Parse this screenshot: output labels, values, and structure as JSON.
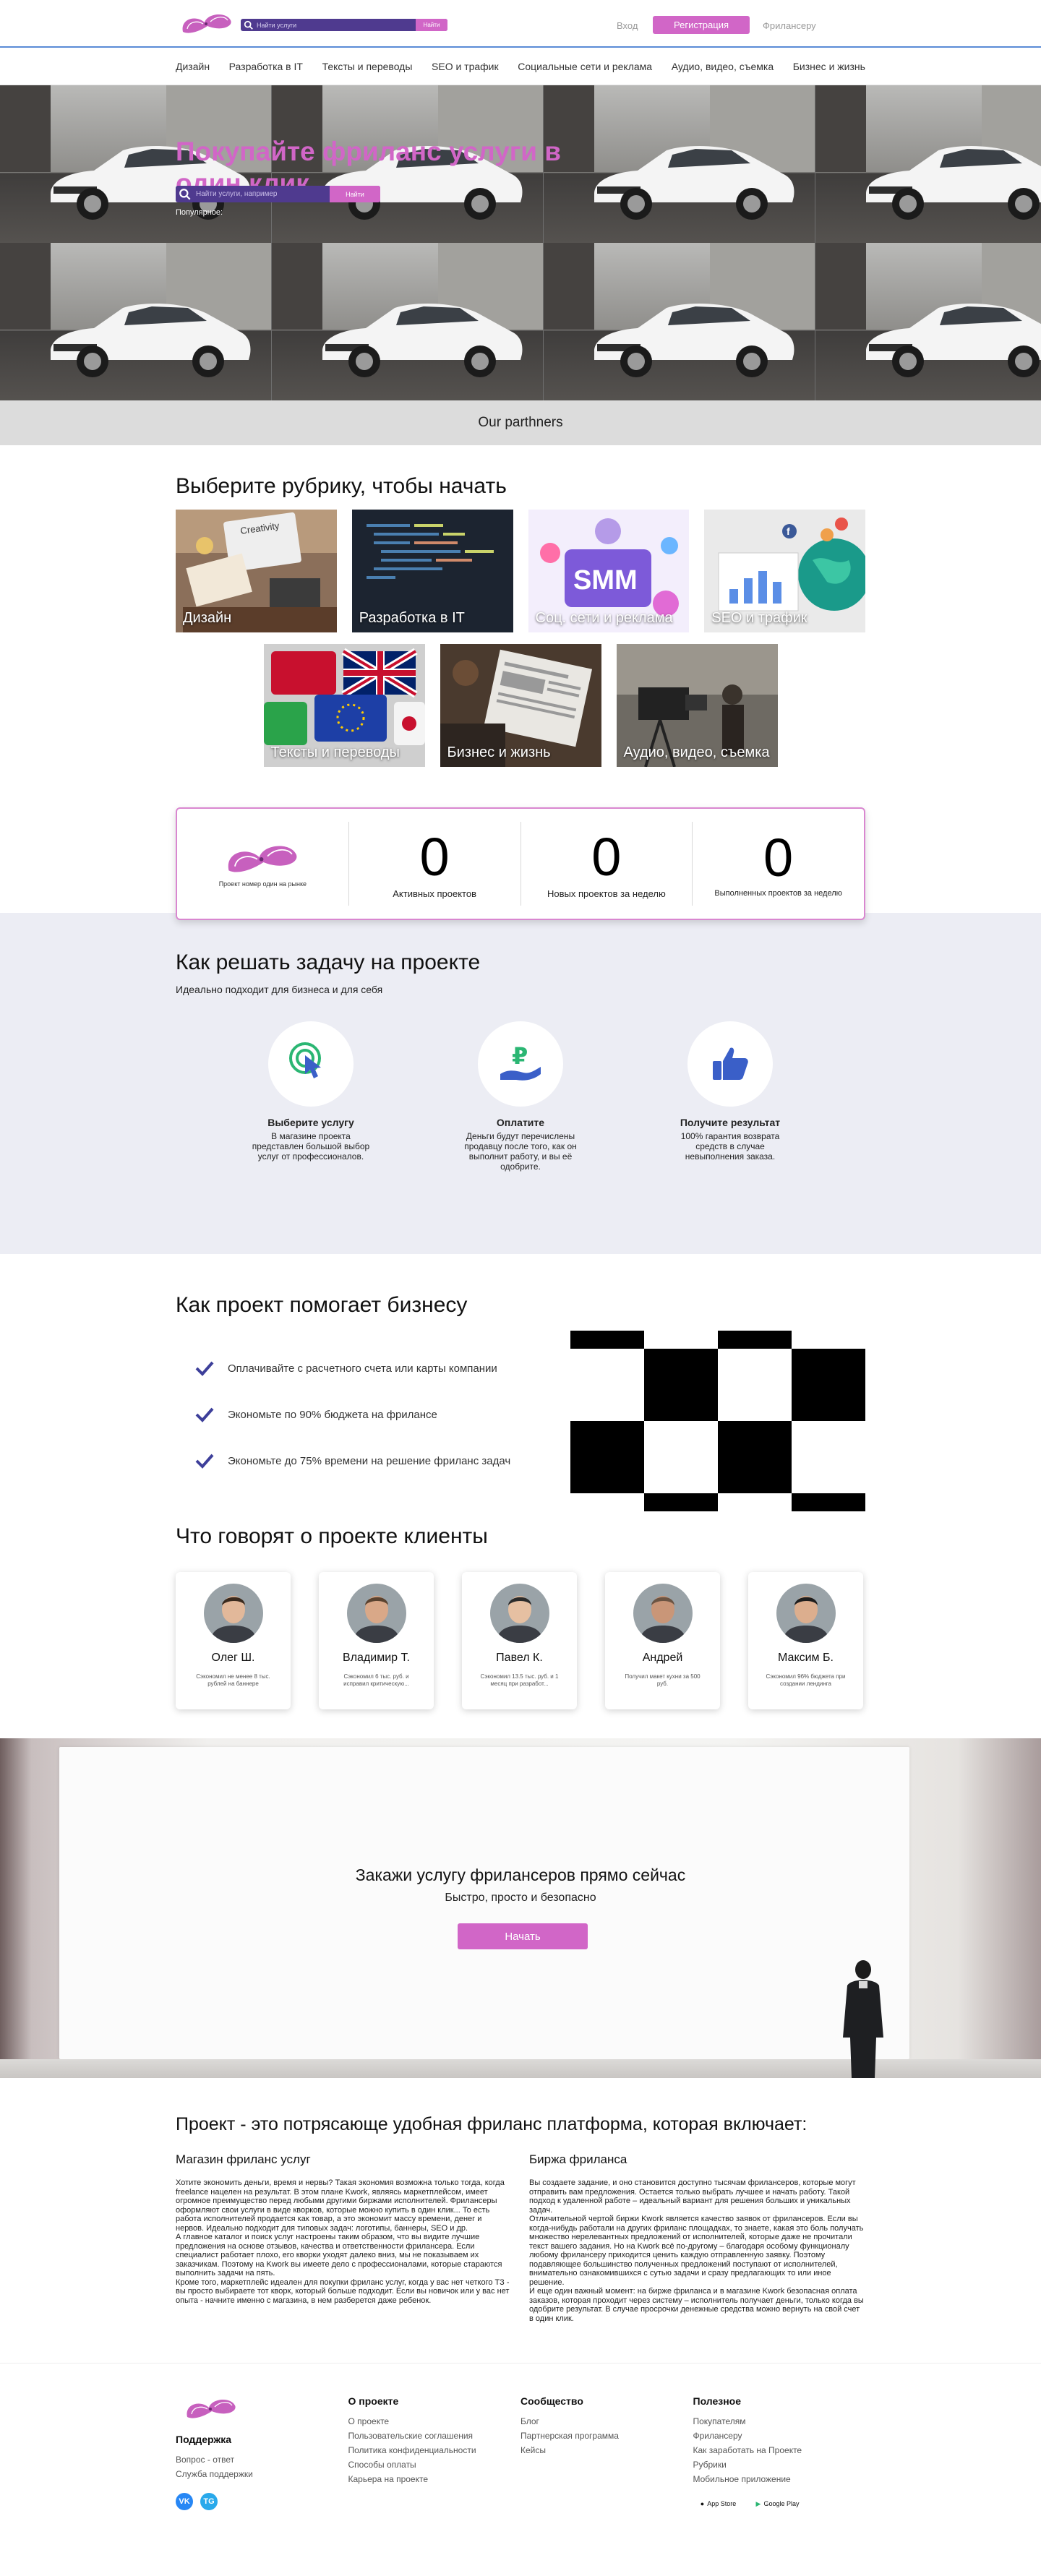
{
  "header": {
    "search_placeholder": "Найти услуги",
    "search_button": "Найти",
    "login": "Вход",
    "register": "Регистрация",
    "freelance": "Фрилансеру"
  },
  "categories": [
    "Дизайн",
    "Разработка в IT",
    "Тексты и переводы",
    "SEO и трафик",
    "Социальные сети и реклама",
    "Аудио, видео, съемка",
    "Бизнес и жизнь"
  ],
  "hero": {
    "title": "Покупайте фриланс услуги в один клик",
    "search_placeholder": "Найти услуги, например",
    "search_button": "Найти",
    "popular": "Популярное:"
  },
  "partners": "Our parthners",
  "rubrics": {
    "title": "Выберите рубрику, чтобы начать",
    "items": [
      {
        "label": "Дизайн"
      },
      {
        "label": "Разработка в IT"
      },
      {
        "label": "Соц. сети и реклама"
      },
      {
        "label": "SEO и трафик"
      },
      {
        "label": "Тексты и переводы"
      },
      {
        "label": "Бизнес и жизнь"
      },
      {
        "label": "Аудио, видео, съемка"
      }
    ]
  },
  "stats": {
    "slogan": "Проект номер один на рынке",
    "items": [
      {
        "value": "0",
        "label": "Активных проектов"
      },
      {
        "value": "0",
        "label": "Новых проектов за неделю"
      },
      {
        "value": "0",
        "label": "Выполненных проектов за неделю"
      }
    ]
  },
  "how": {
    "title": "Как решать задачу на проекте",
    "subtitle": "Идеально подходит для бизнеса и для себя",
    "steps": [
      {
        "icon": "pointer-click-icon",
        "title": "Выберите услугу",
        "text": "В магазине проекта представлен большой выбор услуг от профессионалов."
      },
      {
        "icon": "ruble-hand-icon",
        "title": "Оплатите",
        "text": "Деньги будут перечислены продавцу после того, как он выполнит работу, и вы её одобрите."
      },
      {
        "icon": "thumbs-up-icon",
        "title": "Получите результат",
        "text": "100% гарантия возврата средств в случае невыполнения заказа."
      }
    ]
  },
  "helps": {
    "title": "Как проект помогает бизнесу",
    "items": [
      "Оплачивайте с расчетного счета или карты компании",
      "Экономьте по 90% бюджета на фрилансе",
      "Экономьте до 75% времени на решение фриланс задач"
    ]
  },
  "reviews": {
    "title": "Что говорят о проекте клиенты",
    "items": [
      {
        "name": "Олег Ш.",
        "text": "Сэкономил не менее 8 тыс. рублей на баннере"
      },
      {
        "name": "Владимир Т.",
        "text": "Сэкономил 6 тыс. руб. и исправил критическую..."
      },
      {
        "name": "Павел К.",
        "text": "Сэкономил 13.5 тыс. руб. и 1 месяц при разработ..."
      },
      {
        "name": "Андрей",
        "text": "Получил макет кухни за 500 руб."
      },
      {
        "name": "Максим Б.",
        "text": "Сэкономил 96% бюджета при создании лендинга"
      }
    ]
  },
  "cta": {
    "title": "Закажи услугу фрилансеров прямо сейчас",
    "subtitle": "Быстро, просто и безопасно",
    "button": "Начать"
  },
  "platform": {
    "title": "Проект - это потрясающе удобная фриланс платформа, которая включает:",
    "left_title": "Магазин фриланс услуг",
    "left_text": "Хотите экономить деньги, время и нервы? Такая экономия возможна только тогда, когда freelance нацелен на результат. В этом плане Kwork, являясь маркетплейсом, имеет огромное преимущество перед любыми другими биржами исполнителей. Фрилансеры оформляют свои услуги в виде кворков, которые можно купить в один клик... То есть работа исполнителей продается как товар, а это экономит массу времени, денег и нервов. Идеально подходит для типовых задач: логотипы, баннеры, SEO и др.\nА главное каталог и поиск услуг настроены таким образом, что вы видите лучшие предложения на основе отзывов, качества и ответственности фрилансера. Если специалист работает плохо, его кворки уходят далеко вниз, мы не показываем их заказчикам. Поэтому на Kwork вы имеете дело с профессионалами, которые стараются выполнить задачи на пять.\nКроме того, маркетплейс идеален для покупки фриланс услуг, когда у вас нет четкого ТЗ - вы просто выбираете тот кворк, который больше подходит. Если вы новичок или у вас нет опыта - начните именно с магазина, в нем разберется даже ребенок.",
    "right_title": "Биржа фриланса",
    "right_text": "Вы создаете задание, и оно становится доступно тысячам фрилансеров, которые могут отправить вам предложения. Остается только выбрать лучшее и начать работу. Такой подход к удаленной работе – идеальный вариант для решения больших и уникальных задач.\nОтличительной чертой биржи Kwork является качество заявок от фрилансеров. Если вы когда-нибудь работали на других фриланс площадках, то знаете, какая это боль получать множество нерелевантных предложений от исполнителей, которые даже не прочитали текст вашего задания. Но на Kwork всё по-другому – благодаря особому функционалу любому фрилансеру приходится ценить каждую отправленную заявку. Поэтому подавляющее большинство полученных предложений поступают от исполнителей, внимательно ознакомившихся с сутью задачи и сразу предлагающих то или иное решение.\nИ еще один важный момент: на бирже фриланса и в магазине Kwork безопасная оплата заказов, которая проходит через систему – исполнитель получает деньги, только когда вы одобрите результат. В случае просрочки денежные средства можно вернуть на свой счет в один клик."
  },
  "footer": {
    "support_title": "Поддержка",
    "support_links": [
      "Вопрос - ответ",
      "Служба поддержки"
    ],
    "social": [
      "VK",
      "TG"
    ],
    "about_title": "О проекте",
    "about_links": [
      "О проекте",
      "Пользовательские соглашения",
      "Политика конфиденциальности",
      "Способы оплаты",
      "Карьера на проекте"
    ],
    "community_title": "Сообщество",
    "community_links": [
      "Блог",
      "Партнерская программа",
      "Кейсы"
    ],
    "useful_title": "Полезное",
    "useful_links": [
      "Покупателям",
      "Фрилансеру",
      "Как заработать на Проекте",
      "Рубрики",
      "Мобильное приложение"
    ],
    "app_store": "App Store",
    "google_play": "Google Play"
  }
}
